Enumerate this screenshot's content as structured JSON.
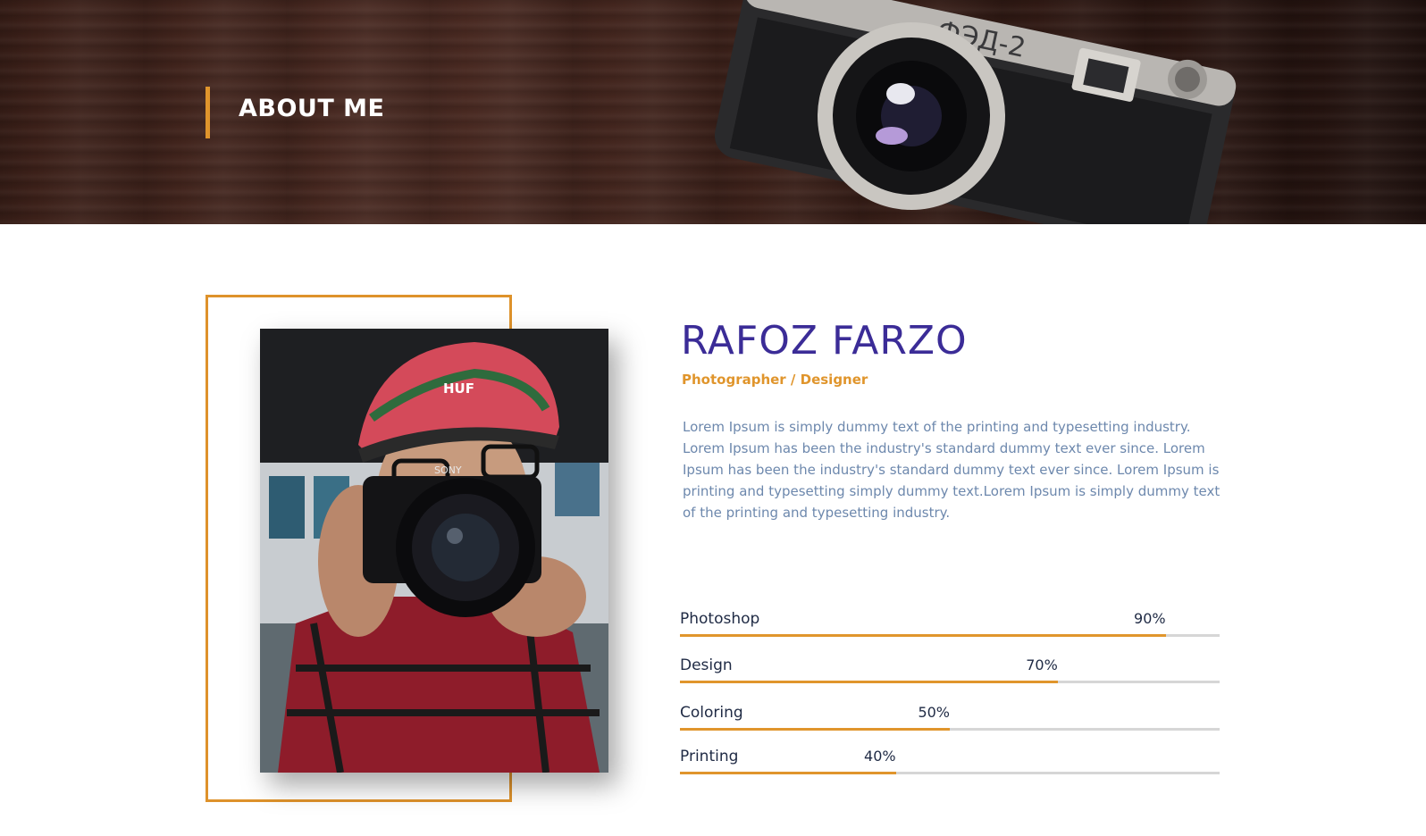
{
  "header": {
    "title": "ABOUT ME"
  },
  "profile": {
    "name": "RAFOZ FARZO",
    "role": "Photographer / Designer",
    "bio": "Lorem Ipsum is simply dummy text of the printing and typesetting industry. Lorem Ipsum has been the industry's standard dummy text ever since. Lorem Ipsum has been the industry's standard dummy text ever since. Lorem Ipsum is printing and typesetting simply dummy text.Lorem Ipsum is simply dummy text of the printing and typesetting industry."
  },
  "skills": [
    {
      "name": "Photoshop",
      "percent_label": "90%",
      "level": 0.9
    },
    {
      "name": "Design",
      "percent_label": "70%",
      "level": 0.7
    },
    {
      "name": "Coloring",
      "percent_label": "50%",
      "level": 0.5
    },
    {
      "name": "Printing",
      "percent_label": "40%",
      "level": 0.4
    }
  ],
  "colors": {
    "accent": "#e0952c",
    "name": "#3b2c97",
    "body_text": "#6d88ad",
    "skill_text": "#1f2a44",
    "track": "#d6d6d6"
  },
  "icons": {
    "hero_image": "vintage-camera",
    "portrait": "photographer-portrait"
  }
}
